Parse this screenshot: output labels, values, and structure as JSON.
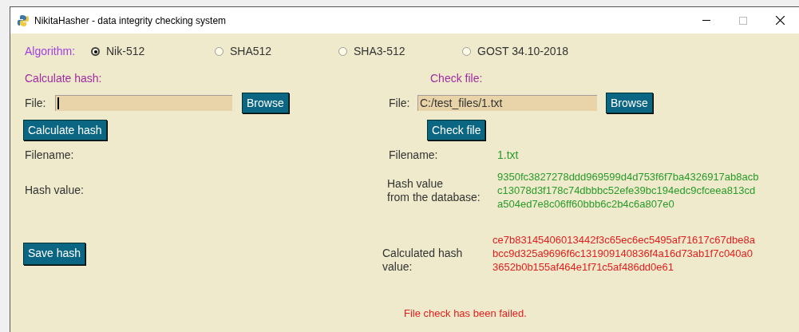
{
  "window": {
    "title": "NikitaHasher - data integrity checking system"
  },
  "algorithm": {
    "label": "Algorithm:",
    "options": [
      {
        "label": "Nik-512",
        "selected": true
      },
      {
        "label": "SHA512",
        "selected": false
      },
      {
        "label": "SHA3-512",
        "selected": false
      },
      {
        "label": "GOST 34.10-2018",
        "selected": false
      }
    ]
  },
  "calculate": {
    "heading": "Calculate hash:",
    "file_label": "File:",
    "browse_button": "Browse",
    "calculate_button": "Calculate hash",
    "filename_label": "Filename:",
    "hash_label": "Hash value:",
    "save_button": "Save hash"
  },
  "check": {
    "heading": "Check file:",
    "file_label": "File:",
    "file_value": "C:/test_files/1.txt",
    "browse_button": "Browse",
    "check_button": "Check file",
    "filename_label": "Filename:",
    "filename_value": "1.txt",
    "db_hash_label": [
      "Hash value",
      "from the database:"
    ],
    "db_hash_lines": [
      "9350fc3827278ddd969599d4d753f6f7ba4326917ab8acb",
      "c13078d3f178c74dbbbc52efe39bc194edc9cfceea813cd",
      "a504ed7e8c06ff60bbb6c2b4c6a807e0"
    ],
    "calc_hash_label": [
      "Calculated hash",
      "value:"
    ],
    "calc_hash_lines": [
      "ce7b83145406013442f3c65ec6ec5495af71617c67dbe8a",
      "bcc9d325a9696f6c131909140836f4a16d73ab1f7c040a0",
      "3652b0b155af464e1f71c5af486dd0e61"
    ]
  },
  "status": {
    "text": "File check has been failed.",
    "failed": true
  }
}
